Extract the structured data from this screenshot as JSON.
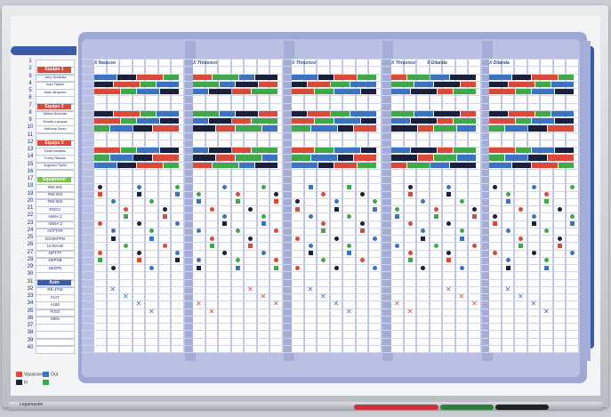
{
  "rows": [
    "1",
    "2",
    "3",
    "4",
    "5",
    "6",
    "7",
    "8",
    "9",
    "10",
    "11",
    "12",
    "13",
    "14",
    "15",
    "16",
    "17",
    "18",
    "19",
    "20",
    "21",
    "22",
    "23",
    "24",
    "25",
    "26",
    "27",
    "28",
    "29",
    "30",
    "31",
    "32",
    "33",
    "34",
    "35",
    "36",
    "37",
    "38",
    "39",
    "40"
  ],
  "groups": [
    {
      "label": "Equipo 1",
      "color": "#d94a37"
    },
    {
      "label": "Equipo 2",
      "color": "#d94a37"
    },
    {
      "label": "Equipo 3",
      "color": "#d94a37"
    },
    {
      "label": "Equipment",
      "color": "#7ac24a"
    },
    {
      "label": "Auto",
      "color": "#3b5aa8"
    }
  ],
  "people": [
    "Jarry Sodbala",
    "Ivan Taarar",
    "Alain Braynes",
    "Milina Brochan",
    "Rastila Larssac",
    "Anthony Nuan",
    "Rola Iveralles",
    "Forny Rabaio",
    "Augusta Tijolio"
  ],
  "equipment": [
    "RW 001",
    "RW 002",
    "RW 003",
    "ROCC",
    "ANNA 1",
    "ANNA 2",
    "HATTAR",
    "DOOKPPB",
    "KLNAAB",
    "OPTTT",
    "DEPSB",
    "SEZPE"
  ],
  "vehicles": [
    "RE-4TW",
    "FIAT",
    "AUDI",
    "FIGO",
    "MINI"
  ],
  "column_headers": [
    [
      "X Neiasso"
    ],
    [
      "X Thrasnco"
    ],
    [
      "X Thrasnco"
    ],
    [
      "X Thrasnco",
      "X Dilanda"
    ],
    [
      "X Dilanda"
    ]
  ],
  "legend": [
    {
      "label": "Vacaciones",
      "color": "#d94a37"
    },
    {
      "label": "Out",
      "color": "#3b73c0"
    },
    {
      "label": "In",
      "color": "#1a1f3a"
    },
    {
      "label": "",
      "color": "#3fa84a"
    }
  ],
  "brand": "Legamaster",
  "colors": {
    "red": "#d94a37",
    "blue": "#3b73c0",
    "navy": "#1a1f3a",
    "green": "#3fa84a",
    "board": "#b9c0e3"
  }
}
